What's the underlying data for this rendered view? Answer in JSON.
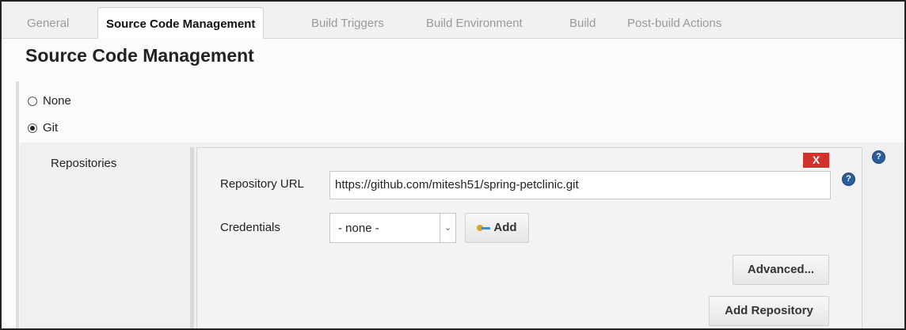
{
  "tabs": [
    {
      "label": "General",
      "active": false
    },
    {
      "label": "Source Code Management",
      "active": true
    },
    {
      "label": "Build Triggers",
      "active": false
    },
    {
      "label": "Build Environment",
      "active": false
    },
    {
      "label": "Build",
      "active": false
    },
    {
      "label": "Post-build Actions",
      "active": false
    }
  ],
  "section": {
    "title": "Source Code Management",
    "options": [
      {
        "label": "None",
        "selected": false
      },
      {
        "label": "Git",
        "selected": true
      }
    ]
  },
  "git": {
    "repositories_label": "Repositories",
    "delete_label": "X",
    "repository_url_label": "Repository URL",
    "repository_url_value": "https://github.com/mitesh51/spring-petclinic.git",
    "credentials_label": "Credentials",
    "credentials_value": "- none -",
    "add_credentials_label": "Add",
    "advanced_label": "Advanced...",
    "add_repository_label": "Add Repository",
    "help_glyph": "?"
  },
  "colors": {
    "delete_button": "#d2322d",
    "help_icon": "#2b5d9a",
    "key_bow": "#d8a51c",
    "key_shaft": "#3c8fd6"
  },
  "icons": [
    "help-icon",
    "key-icon",
    "chevron-down-icon",
    "radio-icon"
  ]
}
